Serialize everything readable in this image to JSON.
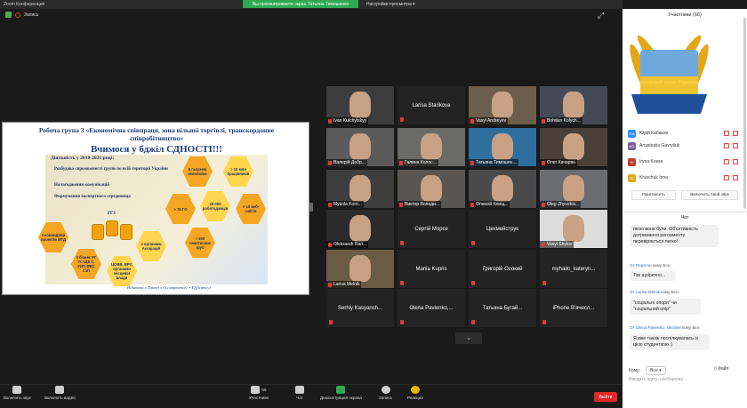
{
  "window": {
    "title": "Zoom Конференция"
  },
  "banner": {
    "text": "Вы просматриваете экран Татьяна Тимошенко"
  },
  "view_options": {
    "label": "Настройки просмотра ▾"
  },
  "recording": {
    "label": "Запись"
  },
  "slide": {
    "heading": "Робоча група 3 «Економічна співпраця, зона вільної торгівлі, транскордонне співробітництво»",
    "subheading": "Вчимося у бджіл СДНОСТІ!!!",
    "section_title": "Діяльність у 2018-2021 році:",
    "bullets": [
      "Розбудова спроможності групи по всій території України",
      "Налагодження комунікацій",
      "Формування експертного середовища"
    ],
    "jar_label": "РГ3",
    "hexes": [
      "8 галузеві економіки",
      "> 10 млн працівників",
      "> 76 ГО",
      "20 000 роботодавців",
      "> 10 веб-сайтів",
      "3 командами проектів МТД",
      "3 органами Асоціацій",
      "> 200 тематичних груп",
      "3 бізнес РГ УС ЩЕ С. УИП ФЕС СзП",
      "ЦОВВ, ВРУ, органами місцевої влади"
    ],
    "footer": "Н(human) x Т(time) x С(competence) = Ef(ficiency)"
  },
  "tiles": [
    {
      "name": "Ivan Kulchytskyy",
      "type": "video"
    },
    {
      "name": "Larisa Starikova",
      "type": "text"
    },
    {
      "name": "Vasyl Andreyev",
      "type": "video"
    },
    {
      "name": "Bohdan Kolych...",
      "type": "video"
    },
    {
      "name": "Валерій Добр...",
      "type": "video"
    },
    {
      "name": "Галина Колос...",
      "type": "video"
    },
    {
      "name": "Татьяна Тимошен...",
      "type": "video"
    },
    {
      "name": "Олег Качарян",
      "type": "video"
    },
    {
      "name": "Mykola Koro...",
      "type": "video"
    },
    {
      "name": "Виктор Володи...",
      "type": "video"
    },
    {
      "name": "Олексій Клищ...",
      "type": "video"
    },
    {
      "name": "Oleg Zhyvotov...",
      "type": "video"
    },
    {
      "name": "Oleksandr Bari...",
      "type": "video"
    },
    {
      "name": "Сергій Мороз",
      "type": "text"
    },
    {
      "name": "Цехмейструк",
      "type": "text"
    },
    {
      "name": "Vasyl Shylov",
      "type": "video"
    },
    {
      "name": "Larisa Melnik",
      "type": "video"
    },
    {
      "name": "Mariia Kupris",
      "type": "text"
    },
    {
      "name": "Григорій Осокий",
      "type": "text"
    },
    {
      "name": "myhailo_kateryn...",
      "type": "text"
    },
    {
      "name": "Serhiy Kasyanch...",
      "type": "text"
    },
    {
      "name": "Olena Pavlenko,...",
      "type": "text"
    },
    {
      "name": "Татьяна Бугай...",
      "type": "text"
    },
    {
      "name": "iPhone B'ячесл...",
      "type": "text"
    }
  ],
  "toolbar": {
    "mute": "Включить звук",
    "video": "Включить видео",
    "participants": "Участники",
    "participants_count": "66",
    "chat": "Чат",
    "share": "Демонстрация экрана",
    "record": "Запись",
    "reactions": "Реакции",
    "end": "Выйти"
  },
  "panel": {
    "participants_title": "Участники (66)",
    "participants": [
      {
        "initials": "ЮК",
        "name": "Юрій Кабаков"
      },
      {
        "initials": "AG",
        "name": "Anastasiia Gavryliuk"
      },
      {
        "initials": "IK",
        "name": "Iryna Kosse"
      },
      {
        "initials": "KI",
        "name": "Kravchuk Inna"
      }
    ],
    "invite": "Пригласить",
    "unmute_me": "Включить свой звук",
    "logo_text": "Аграрний союз України",
    "chat_title": "Чат",
    "messages": [
      {
        "from": "",
        "to": "",
        "text": "якою вони були. Об'єктивність дотримання регламенту перевіряється легко!"
      },
      {
        "from": "От Перегон",
        "to": "кому Все:",
        "text": "Так щоірично..."
      },
      {
        "from": "От Larisa Melnik",
        "to": "кому Все:",
        "text": "\"соціальні опори\" чи \"соціальний опір\""
      },
      {
        "from": "От Olena Pavlenko, Ukraine",
        "to": "кому Все:",
        "text": "Я вже також поспілкувалась із цією студенткою :)"
      }
    ],
    "to_label": "Кому:",
    "to_value": "Все",
    "file": "Файл",
    "input_placeholder": "Введите здесь сообщение..."
  },
  "colors": {
    "accent": "#2d8cff",
    "banner": "#2fa84f",
    "end": "#e02828"
  }
}
